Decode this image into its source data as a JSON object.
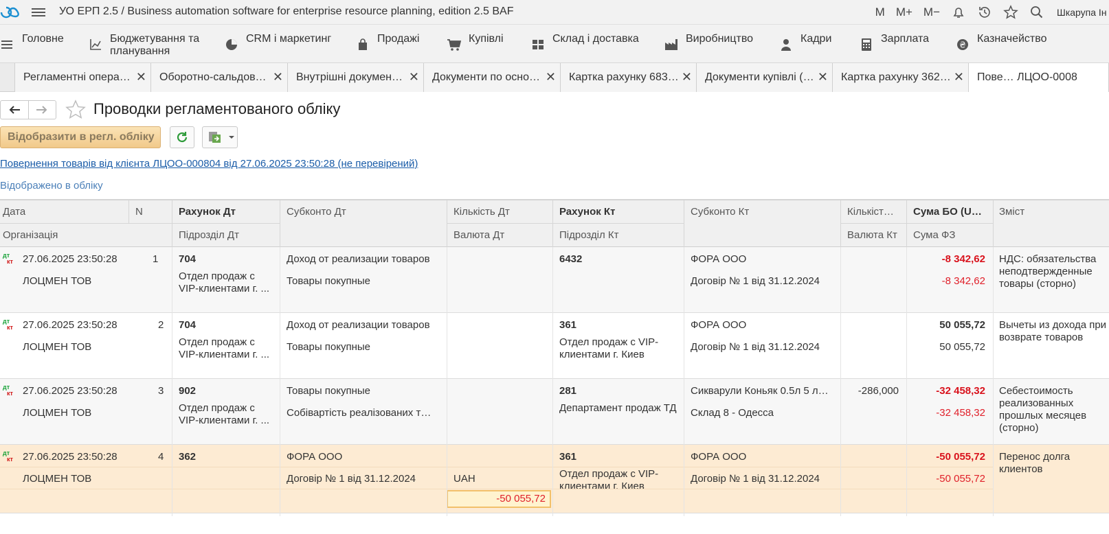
{
  "app": {
    "title": "УО ЕРП 2.5 / Business automation software for enterprise resource planning, edition 2.5 BAF",
    "user": "Шкарупа Ін",
    "memory_buttons": [
      "M",
      "M+",
      "M−"
    ]
  },
  "sections": [
    {
      "label": "Головне",
      "icon": "menu-icon"
    },
    {
      "label": "Бюджетування та планування",
      "icon": "chart-axis-icon"
    },
    {
      "label": "CRM і маркетинг",
      "icon": "pie-icon"
    },
    {
      "label": "Продажі",
      "icon": "bag-icon"
    },
    {
      "label": "Купівлі",
      "icon": "cart-icon"
    },
    {
      "label": "Склад і доставка",
      "icon": "boxes-icon"
    },
    {
      "label": "Виробництво",
      "icon": "factory-icon"
    },
    {
      "label": "Кадри",
      "icon": "person-icon"
    },
    {
      "label": "Зарплата",
      "icon": "calculator-icon"
    },
    {
      "label": "Казначейство",
      "icon": "coin-icon"
    }
  ],
  "tabs": [
    {
      "label": "Регламентні операц…"
    },
    {
      "label": "Оборотно-сальдова…"
    },
    {
      "label": "Внутрішні документ…"
    },
    {
      "label": "Документи по основ…"
    },
    {
      "label": "Картка рахунку 683 …"
    },
    {
      "label": "Документи купівлі (всі)"
    },
    {
      "label": "Картка рахунку 362 …"
    },
    {
      "label": "Пове… ЛЦОО-0008"
    }
  ],
  "form": {
    "title": "Проводки регламентованого обліку",
    "primary_button": "Відобразити в регл. обліку",
    "document_link": "Повернення товарів від клієнта ЛЦОО-000804 від 27.06.2025 23:50:28 (не перевірений)",
    "status_text": "Відображено в обліку"
  },
  "table": {
    "headers": {
      "date": "Дата",
      "n": "N",
      "acc_dt": "Рахунок Дт",
      "sub_dt": "Субконто Дт",
      "qty_dt": "Кількість Дт",
      "acc_kt": "Рахунок Кт",
      "sub_kt": "Субконто Кт",
      "qty_kt": "Кількіст…",
      "sum_bo": "Сума БО (U…",
      "content": "Зміст",
      "org": "Організація",
      "div_dt": "Підрозділ Дт",
      "cur_dt": "Валюта Дт",
      "div_kt": "Підрозділ Кт",
      "cur_kt": "Валюта Кт",
      "sum_fz": "Сума ФЗ"
    },
    "rows": [
      {
        "date": "27.06.2025 23:50:28",
        "n": "1",
        "org": "ЛОЦМЕН ТОВ",
        "acc_dt": "704",
        "div_dt": "Отдел продаж с VIP-клиентами г. ...",
        "sub_dt_1": "Доход от реализации товаров",
        "sub_dt_2": "Товары покупные",
        "qty_dt": "",
        "cur_dt": "",
        "acc_kt": "6432",
        "div_kt": "",
        "sub_kt_1": "ФОРА ООО",
        "sub_kt_2": "Договір № 1 від 31.12.2024",
        "qty_kt": "",
        "sum_bo": "-8 342,62",
        "sum_fz": "-8 342,62",
        "content": "НДС: обязательства неподтвержденные товары (сторно)"
      },
      {
        "date": "27.06.2025 23:50:28",
        "n": "2",
        "org": "ЛОЦМЕН ТОВ",
        "acc_dt": "704",
        "div_dt": "Отдел продаж с VIP-клиентами г. ...",
        "sub_dt_1": "Доход от реализации товаров",
        "sub_dt_2": "Товары покупные",
        "qty_dt": "",
        "cur_dt": "",
        "acc_kt": "361",
        "div_kt": "Отдел продаж с VIP-клиентами г. Киев",
        "sub_kt_1": "ФОРА ООО",
        "sub_kt_2": "Договір № 1 від 31.12.2024",
        "qty_kt": "",
        "sum_bo": "50 055,72",
        "sum_fz": "50 055,72",
        "content": "Вычеты из дохода при возврате товаров"
      },
      {
        "date": "27.06.2025 23:50:28",
        "n": "3",
        "org": "ЛОЦМЕН ТОВ",
        "acc_dt": "902",
        "div_dt": "Отдел продаж с VIP-клиентами г. ...",
        "sub_dt_1": "Товары покупные",
        "sub_dt_2": "Собівартість реалізованих т…",
        "qty_dt": "",
        "cur_dt": "",
        "acc_kt": "281",
        "div_kt": "Департамент продаж ТД",
        "sub_kt_1": "Сикварули Коньяк 0.5л 5 л…",
        "sub_kt_2": "Склад 8 - Одесса",
        "qty_kt": "-286,000",
        "sum_bo": "-32 458,32",
        "sum_fz": "-32 458,32",
        "content": "Себестоимость реализованных прошлых месяцев (сторно)"
      },
      {
        "date": "27.06.2025 23:50:28",
        "n": "4",
        "org": "ЛОЦМЕН ТОВ",
        "acc_dt": "362",
        "div_dt": "",
        "sub_dt_1": "ФОРА ООО",
        "sub_dt_2": "Договір № 1 від 31.12.2024",
        "qty_dt": "",
        "cur_dt": "UAH",
        "cur_dt_sum": "-50 055,72",
        "acc_kt": "361",
        "div_kt": "Отдел продаж с VIP-клиентами г. Киев",
        "sub_kt_1": "ФОРА ООО",
        "sub_kt_2": "Договір № 1 від 31.12.2024",
        "qty_kt": "",
        "sum_bo": "-50 055,72",
        "sum_fz": "-50 055,72",
        "content": "Перенос долга клиентов"
      }
    ]
  },
  "colors": {
    "accent_primary": "#f1c98a",
    "negative": "#e0202a",
    "link": "#1a5ca8",
    "selected_row": "#fdebd3"
  }
}
